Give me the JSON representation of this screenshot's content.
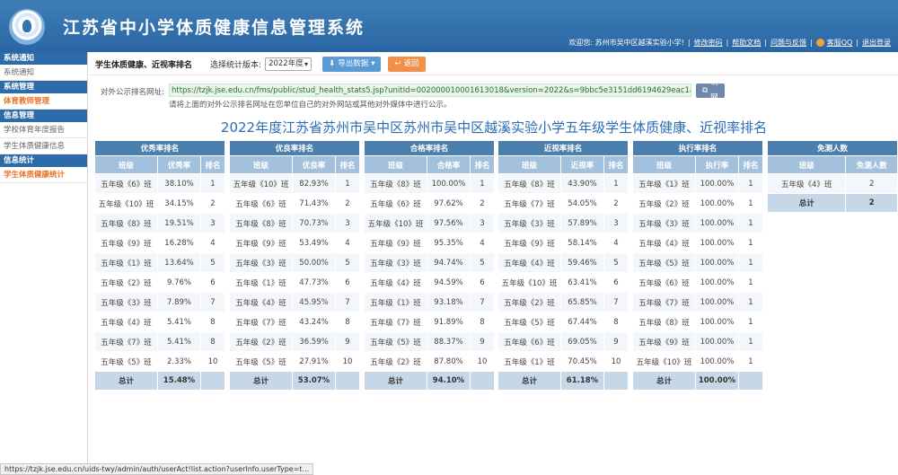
{
  "header": {
    "title": "江苏省中小学体质健康信息管理系统",
    "welcome": "欢迎您: 苏州市吴中区越溪实验小学!",
    "links": [
      "修改密码",
      "帮助文档",
      "问题与反馈",
      "客服QQ",
      "退出登录"
    ]
  },
  "sidebar": [
    {
      "head": "系统通知",
      "items": [
        "系统通知"
      ]
    },
    {
      "head": "系统管理",
      "items": [
        "体育教师管理"
      ]
    },
    {
      "head": "信息管理",
      "items": [
        "学校体育年度报告",
        "学生体质健康信息"
      ]
    },
    {
      "head": "信息统计",
      "items": [
        "学生体质健康统计"
      ]
    }
  ],
  "toolbar": {
    "page_label": "学生体质健康、近视率排名",
    "version_label": "选择统计版本:",
    "version_value": "2022年度",
    "export_label": "导出数据",
    "back_label": "返回"
  },
  "public_url": {
    "label": "对外公示排名网址:",
    "url": "https://tzjk.jse.edu.cn/fms/public/stud_health_stats5.jsp?unitId=002000010001613018&version=2022&s=9bbc5e3151dd6194629eac1a71000f91",
    "copy_label": "复制网址",
    "note": "请将上面的对外公示排名网址在您单位自己的对外网站或其他对外媒体中进行公示。"
  },
  "main_title": "2022年度江苏省苏州市吴中区苏州市吴中区越溪实验小学五年级学生体质健康、近视率排名",
  "tables": [
    {
      "caption": "优秀率排名",
      "columns": [
        "班级",
        "优秀率",
        "排名"
      ],
      "rows": [
        [
          "五年级《6》班",
          "38.10%",
          "1"
        ],
        [
          "五年级《10》班",
          "34.15%",
          "2"
        ],
        [
          "五年级《8》班",
          "19.51%",
          "3"
        ],
        [
          "五年级《9》班",
          "16.28%",
          "4"
        ],
        [
          "五年级《1》班",
          "13.64%",
          "5"
        ],
        [
          "五年级《2》班",
          "9.76%",
          "6"
        ],
        [
          "五年级《3》班",
          "7.89%",
          "7"
        ],
        [
          "五年级《4》班",
          "5.41%",
          "8"
        ],
        [
          "五年级《7》班",
          "5.41%",
          "8"
        ],
        [
          "五年级《5》班",
          "2.33%",
          "10"
        ]
      ],
      "total": [
        "总计",
        "15.48%"
      ]
    },
    {
      "caption": "优良率排名",
      "columns": [
        "班级",
        "优良率",
        "排名"
      ],
      "rows": [
        [
          "五年级《10》班",
          "82.93%",
          "1"
        ],
        [
          "五年级《6》班",
          "71.43%",
          "2"
        ],
        [
          "五年级《8》班",
          "70.73%",
          "3"
        ],
        [
          "五年级《9》班",
          "53.49%",
          "4"
        ],
        [
          "五年级《3》班",
          "50.00%",
          "5"
        ],
        [
          "五年级《1》班",
          "47.73%",
          "6"
        ],
        [
          "五年级《4》班",
          "45.95%",
          "7"
        ],
        [
          "五年级《7》班",
          "43.24%",
          "8"
        ],
        [
          "五年级《2》班",
          "36.59%",
          "9"
        ],
        [
          "五年级《5》班",
          "27.91%",
          "10"
        ]
      ],
      "total": [
        "总计",
        "53.07%"
      ]
    },
    {
      "caption": "合格率排名",
      "columns": [
        "班级",
        "合格率",
        "排名"
      ],
      "rows": [
        [
          "五年级《8》班",
          "100.00%",
          "1"
        ],
        [
          "五年级《6》班",
          "97.62%",
          "2"
        ],
        [
          "五年级《10》班",
          "97.56%",
          "3"
        ],
        [
          "五年级《9》班",
          "95.35%",
          "4"
        ],
        [
          "五年级《3》班",
          "94.74%",
          "5"
        ],
        [
          "五年级《4》班",
          "94.59%",
          "6"
        ],
        [
          "五年级《1》班",
          "93.18%",
          "7"
        ],
        [
          "五年级《7》班",
          "91.89%",
          "8"
        ],
        [
          "五年级《5》班",
          "88.37%",
          "9"
        ],
        [
          "五年级《2》班",
          "87.80%",
          "10"
        ]
      ],
      "total": [
        "总计",
        "94.10%"
      ]
    },
    {
      "caption": "近视率排名",
      "columns": [
        "班级",
        "近视率",
        "排名"
      ],
      "rows": [
        [
          "五年级《8》班",
          "43.90%",
          "1"
        ],
        [
          "五年级《7》班",
          "54.05%",
          "2"
        ],
        [
          "五年级《3》班",
          "57.89%",
          "3"
        ],
        [
          "五年级《9》班",
          "58.14%",
          "4"
        ],
        [
          "五年级《4》班",
          "59.46%",
          "5"
        ],
        [
          "五年级《10》班",
          "63.41%",
          "6"
        ],
        [
          "五年级《2》班",
          "65.85%",
          "7"
        ],
        [
          "五年级《5》班",
          "67.44%",
          "8"
        ],
        [
          "五年级《6》班",
          "69.05%",
          "9"
        ],
        [
          "五年级《1》班",
          "70.45%",
          "10"
        ]
      ],
      "total": [
        "总计",
        "61.18%"
      ]
    },
    {
      "caption": "执行率排名",
      "columns": [
        "班级",
        "执行率",
        "排名"
      ],
      "rows": [
        [
          "五年级《1》班",
          "100.00%",
          "1"
        ],
        [
          "五年级《2》班",
          "100.00%",
          "1"
        ],
        [
          "五年级《3》班",
          "100.00%",
          "1"
        ],
        [
          "五年级《4》班",
          "100.00%",
          "1"
        ],
        [
          "五年级《5》班",
          "100.00%",
          "1"
        ],
        [
          "五年级《6》班",
          "100.00%",
          "1"
        ],
        [
          "五年级《7》班",
          "100.00%",
          "1"
        ],
        [
          "五年级《8》班",
          "100.00%",
          "1"
        ],
        [
          "五年级《9》班",
          "100.00%",
          "1"
        ],
        [
          "五年级《10》班",
          "100.00%",
          "1"
        ]
      ],
      "total": [
        "总计",
        "100.00%"
      ]
    }
  ],
  "exempt_table": {
    "caption": "免测人数",
    "columns": [
      "班级",
      "免测人数"
    ],
    "rows": [
      [
        "五年级《4》班",
        "2"
      ]
    ],
    "total": [
      "总计",
      "2"
    ]
  },
  "status_url": "https://tzjk.jse.edu.cn/uids-twy/admin/auth/userAct!list.action?userInfo.userType=t..."
}
